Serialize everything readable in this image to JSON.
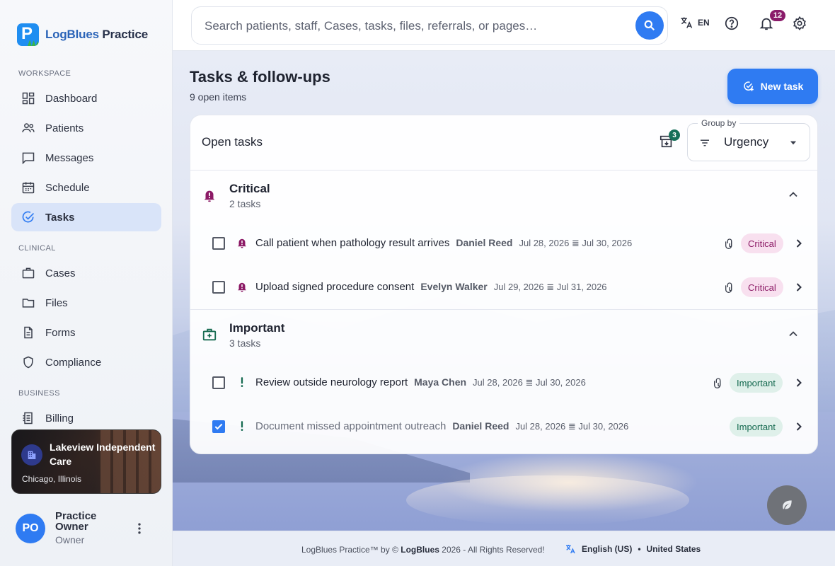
{
  "brand": {
    "name_part1": "LogBlues",
    "name_part2": "Practice"
  },
  "sidebar": {
    "sections": {
      "workspace": "WORKSPACE",
      "clinical": "CLINICAL",
      "business": "BUSINESS"
    },
    "items": {
      "dashboard": "Dashboard",
      "patients": "Patients",
      "messages": "Messages",
      "schedule": "Schedule",
      "tasks": "Tasks",
      "cases": "Cases",
      "files": "Files",
      "forms": "Forms",
      "compliance": "Compliance",
      "billing": "Billing"
    },
    "active": "tasks",
    "org": {
      "name": "Lakeview Independent Care",
      "location": "Chicago, Illinois"
    },
    "user": {
      "initials": "PO",
      "name": "Practice Owner",
      "role": "Owner"
    }
  },
  "topbar": {
    "search_placeholder": "Search patients, staff, Cases, tasks, files, referrals, or pages…",
    "language_code": "EN",
    "notification_count": "12"
  },
  "main": {
    "title": "Tasks & follow-ups",
    "subtitle": "9 open items",
    "new_task_label": "New task",
    "card": {
      "title": "Open tasks",
      "archive_count": "3",
      "group_by_label": "Group by",
      "group_by_value": "Urgency",
      "groups": [
        {
          "name": "Critical",
          "count": "2 tasks",
          "tasks": [
            {
              "title": "Call patient when pathology result arrives",
              "person": "Daniel Reed",
              "dates": "Jul 28, 2026 ≣ Jul 30, 2026",
              "status": "Critical",
              "checked": false
            },
            {
              "title": "Upload signed procedure consent",
              "person": "Evelyn Walker",
              "dates": "Jul 29, 2026 ≣ Jul 31, 2026",
              "status": "Critical",
              "checked": false
            }
          ]
        },
        {
          "name": "Important",
          "count": "3 tasks",
          "tasks": [
            {
              "title": "Review outside neurology report",
              "person": "Maya Chen",
              "dates": "Jul 28, 2026 ≣ Jul 30, 2026",
              "status": "Important",
              "checked": false
            },
            {
              "title": "Document missed appointment outreach",
              "person": "Daniel Reed",
              "dates": "Jul 28, 2026 ≣ Jul 30, 2026",
              "status": "Important",
              "checked": true
            }
          ]
        }
      ]
    }
  },
  "footer": {
    "text_prefix": "LogBlues Practice™ by ©",
    "brand": "LogBlues",
    "text_suffix": "2026 - All Rights Reserved!",
    "language": "English (US)",
    "region": "United States"
  },
  "colors": {
    "accent": "#2f7bf2",
    "critical": "#8c1a66",
    "important": "#14694f",
    "active_nav": "#d9e4f9"
  }
}
